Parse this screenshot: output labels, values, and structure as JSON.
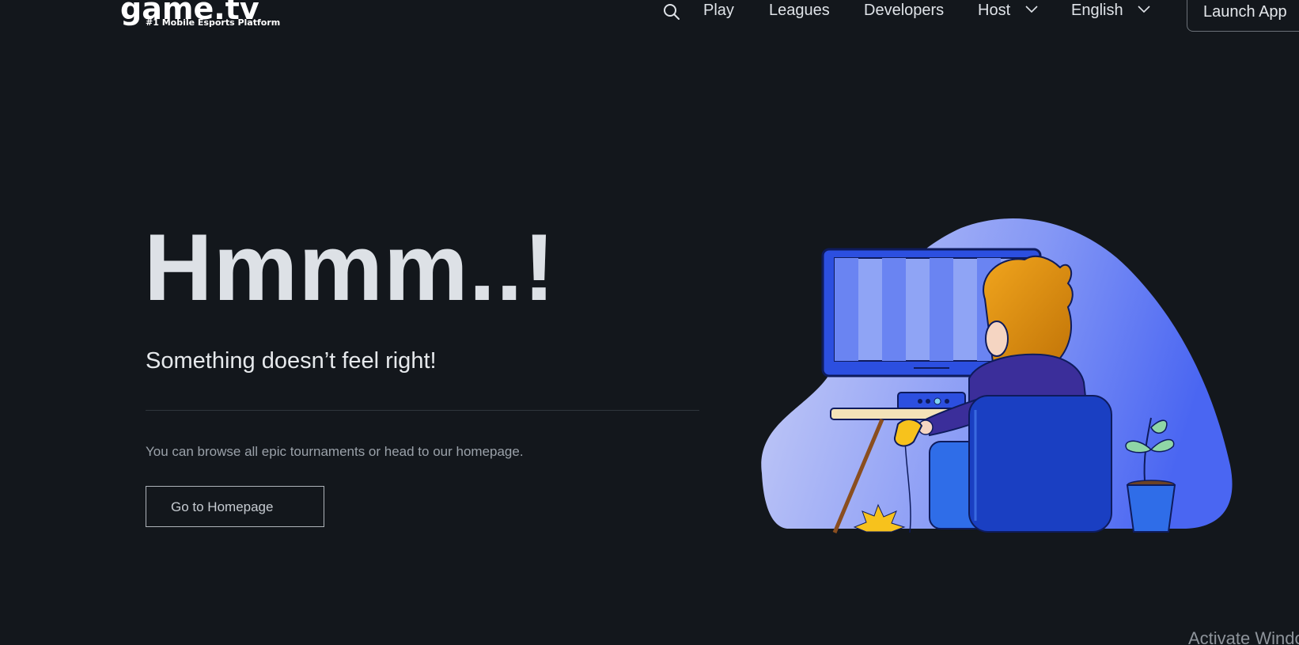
{
  "header": {
    "logo_text": "game.tv",
    "logo_tagline": "#1 Mobile Esports Platform",
    "search_icon": "search-icon",
    "nav": {
      "play": "Play",
      "leagues": "Leagues",
      "developers": "Developers",
      "host": "Host",
      "language": "English"
    },
    "launch_app": "Launch App"
  },
  "main": {
    "headline": "Hmmm..!",
    "subheadline": "Something doesn’t feel right!",
    "description": "You can browse all epic tournaments or head to our homepage.",
    "button_label": "Go to Homepage",
    "illustration_icon": "gamer-at-computer-illustration"
  },
  "os_overlay": {
    "watermark": "Activate Windows"
  },
  "colors": {
    "background": "#13171c",
    "text_primary": "#dde1e6",
    "text_muted": "#9aa1a9",
    "illustration_blue": "#3f63f2"
  }
}
